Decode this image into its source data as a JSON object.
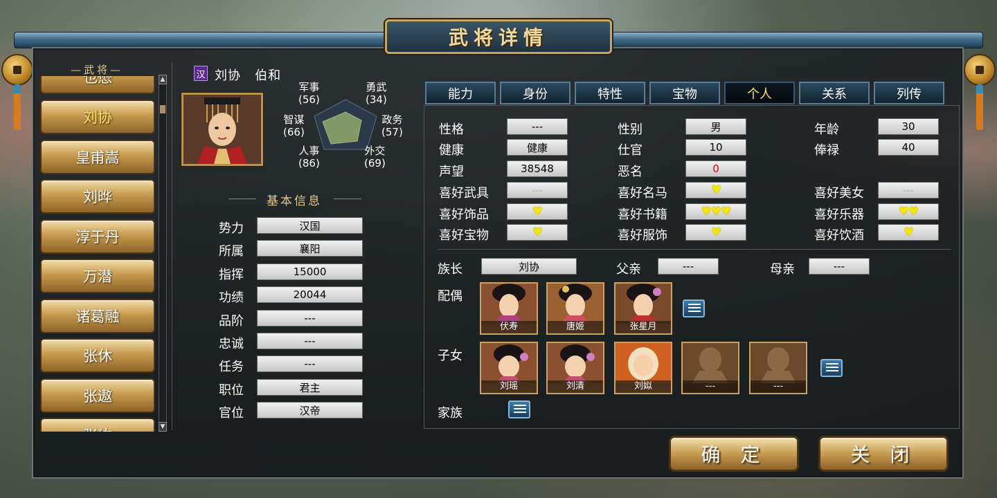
{
  "title": "武将详情",
  "generals_list": {
    "header": "武将",
    "items": [
      "也懋",
      "刘协",
      "皇甫嵩",
      "刘晔",
      "淳于丹",
      "万潜",
      "诸葛融",
      "张休",
      "张遨",
      "张纮"
    ],
    "selected": "刘协"
  },
  "general": {
    "faction_badge": "汉",
    "name": "刘协",
    "courtesy_name": "伯和",
    "stats": {
      "military": {
        "label": "军事",
        "value": "(56)"
      },
      "valor": {
        "label": "勇武",
        "value": "(34)"
      },
      "strategy": {
        "label": "智谋",
        "value": "(66)"
      },
      "politics": {
        "label": "政务",
        "value": "(57)"
      },
      "personnel": {
        "label": "人事",
        "value": "(86)"
      },
      "diplomacy": {
        "label": "外交",
        "value": "(69)"
      }
    }
  },
  "basic_info": {
    "title": "基本信息",
    "rows": [
      {
        "label": "势力",
        "value": "汉国"
      },
      {
        "label": "所属",
        "value": "襄阳"
      },
      {
        "label": "指挥",
        "value": "15000"
      },
      {
        "label": "功绩",
        "value": "20044"
      },
      {
        "label": "品阶",
        "value": "---"
      },
      {
        "label": "忠诚",
        "value": "---"
      },
      {
        "label": "任务",
        "value": "---"
      },
      {
        "label": "职位",
        "value": "君主"
      },
      {
        "label": "官位",
        "value": "汉帝"
      }
    ]
  },
  "tabs": [
    "能力",
    "身份",
    "特性",
    "宝物",
    "个人",
    "关系",
    "列传"
  ],
  "active_tab": "个人",
  "personal": {
    "col1": [
      {
        "label": "性格",
        "value": "---"
      },
      {
        "label": "健康",
        "value": "健康"
      },
      {
        "label": "声望",
        "value": "38548"
      },
      {
        "label": "喜好武具",
        "value": "---"
      },
      {
        "label": "喜好饰品",
        "value": "♥"
      },
      {
        "label": "喜好宝物",
        "value": "♥"
      }
    ],
    "col2": [
      {
        "label": "性别",
        "value": "男"
      },
      {
        "label": "仕官",
        "value": "10"
      },
      {
        "label": "恶名",
        "value": "0"
      },
      {
        "label": "喜好名马",
        "value": "♥"
      },
      {
        "label": "喜好书籍",
        "value": "♥♥♥"
      },
      {
        "label": "喜好服饰",
        "value": "♥"
      }
    ],
    "col3": [
      {
        "label": "年龄",
        "value": "30"
      },
      {
        "label": "俸禄",
        "value": "40"
      },
      {
        "label": "喜好美女",
        "value": "---"
      },
      {
        "label": "喜好乐器",
        "value": "♥♥"
      },
      {
        "label": "喜好饮酒",
        "value": "♥"
      }
    ]
  },
  "family": {
    "clan_head_label": "族长",
    "clan_head": "刘协",
    "father_label": "父亲",
    "father": "---",
    "mother_label": "母亲",
    "mother": "---",
    "spouse_label": "配偶",
    "spouses": [
      "伏寿",
      "唐姬",
      "张星月"
    ],
    "children_label": "子女",
    "children": [
      "刘瑶",
      "刘清",
      "刘姒",
      "---",
      "---"
    ],
    "clan_label": "家族"
  },
  "buttons": {
    "confirm": "确 定",
    "close": "关 闭"
  },
  "colors": {
    "accent_gold": "#e2c98a",
    "selected_yellow": "#ffe55a",
    "heart": "#f3e600",
    "infamy_red": "#e00000"
  }
}
